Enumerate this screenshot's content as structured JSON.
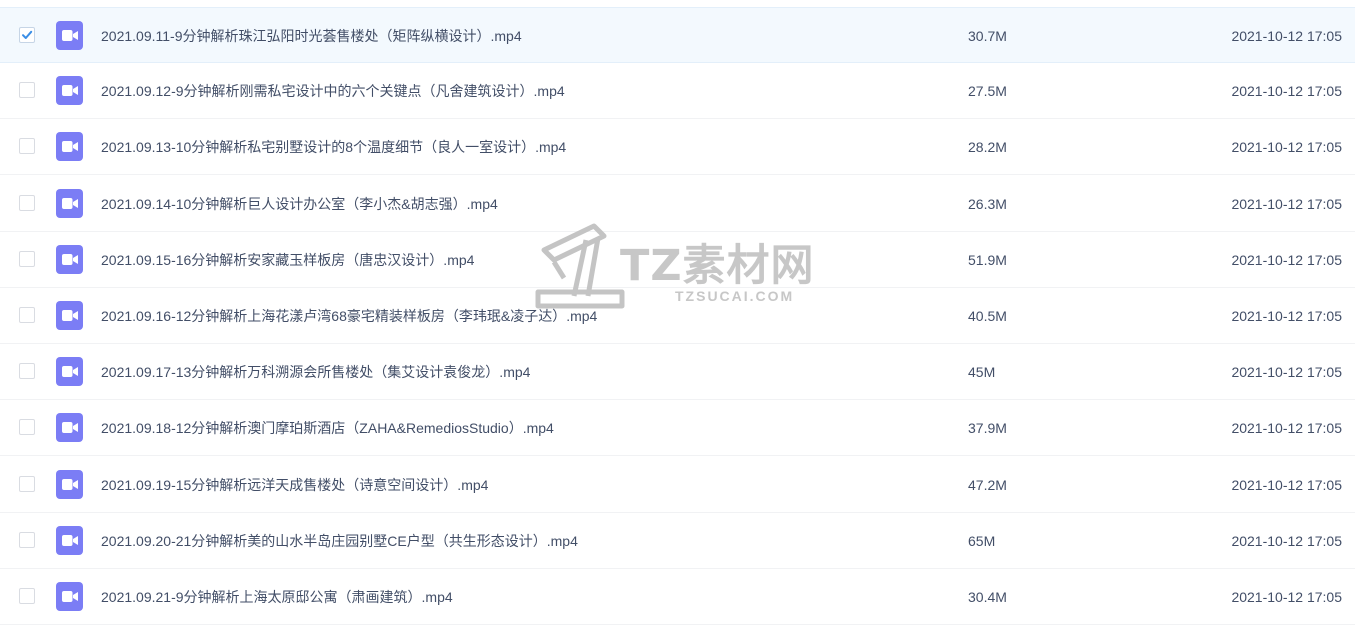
{
  "files": [
    {
      "name": "2021.09.11-9分钟解析珠江弘阳时光荟售楼处（矩阵纵横设计）.mp4",
      "size": "30.7M",
      "date": "2021-10-12 17:05",
      "selected": true
    },
    {
      "name": "2021.09.12-9分钟解析刚需私宅设计中的六个关键点（凡舍建筑设计）.mp4",
      "size": "27.5M",
      "date": "2021-10-12 17:05",
      "selected": false
    },
    {
      "name": "2021.09.13-10分钟解析私宅别墅设计的8个温度细节（良人一室设计）.mp4",
      "size": "28.2M",
      "date": "2021-10-12 17:05",
      "selected": false
    },
    {
      "name": "2021.09.14-10分钟解析巨人设计办公室（李小杰&胡志强）.mp4",
      "size": "26.3M",
      "date": "2021-10-12 17:05",
      "selected": false
    },
    {
      "name": "2021.09.15-16分钟解析安家藏玉样板房（唐忠汉设计）.mp4",
      "size": "51.9M",
      "date": "2021-10-12 17:05",
      "selected": false
    },
    {
      "name": "2021.09.16-12分钟解析上海花漾卢湾68豪宅精装样板房（李玮珉&凌子达）.mp4",
      "size": "40.5M",
      "date": "2021-10-12 17:05",
      "selected": false
    },
    {
      "name": "2021.09.17-13分钟解析万科溯源会所售楼处（集艾设计袁俊龙）.mp4",
      "size": "45M",
      "date": "2021-10-12 17:05",
      "selected": false
    },
    {
      "name": "2021.09.18-12分钟解析澳门摩珀斯酒店（ZAHA&RemediosStudio）.mp4",
      "size": "37.9M",
      "date": "2021-10-12 17:05",
      "selected": false
    },
    {
      "name": "2021.09.19-15分钟解析远洋天成售楼处（诗意空间设计）.mp4",
      "size": "47.2M",
      "date": "2021-10-12 17:05",
      "selected": false
    },
    {
      "name": "2021.09.20-21分钟解析美的山水半岛庄园别墅CE户型（共生形态设计）.mp4",
      "size": "65M",
      "date": "2021-10-12 17:05",
      "selected": false
    },
    {
      "name": "2021.09.21-9分钟解析上海太原邸公寓（肃画建筑）.mp4",
      "size": "30.4M",
      "date": "2021-10-12 17:05",
      "selected": false
    }
  ],
  "file_icon": "video-file-icon",
  "watermark": {
    "title": "TZ素材网",
    "subtitle": "TZSUCAI.COM"
  },
  "colors": {
    "icon_bg": "#7b7df5",
    "checkbox_check": "#3a8ee6",
    "selected_row_bg": "#f3f9fe",
    "text": "#424e67"
  }
}
